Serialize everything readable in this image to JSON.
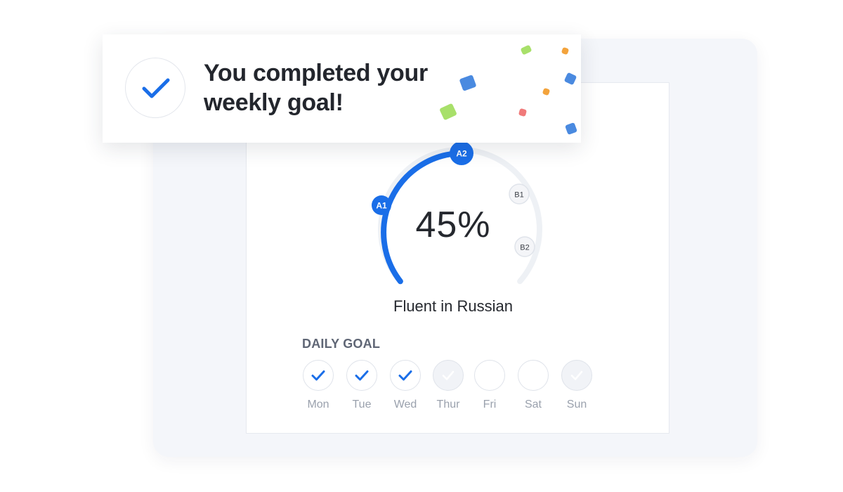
{
  "toast": {
    "title": "You completed your weekly goal!",
    "check_icon": "check-icon"
  },
  "progress": {
    "percent_label": "45%",
    "percent_value": 45,
    "level_label": "Fluent in Russian",
    "milestones": [
      {
        "label": "A1",
        "reached": true
      },
      {
        "label": "A2",
        "reached": true
      },
      {
        "label": "B1",
        "reached": false
      },
      {
        "label": "B2",
        "reached": false
      }
    ]
  },
  "daily_goal": {
    "label": "DAILY GOAL",
    "days": [
      {
        "name": "Mon",
        "state": "done"
      },
      {
        "name": "Tue",
        "state": "done"
      },
      {
        "name": "Wed",
        "state": "done"
      },
      {
        "name": "Thur",
        "state": "done-dim"
      },
      {
        "name": "Fri",
        "state": "empty"
      },
      {
        "name": "Sat",
        "state": "empty"
      },
      {
        "name": "Sun",
        "state": "done-dim"
      }
    ]
  },
  "colors": {
    "accent": "#1a6ee8",
    "track": "#eef1f5",
    "confetti": [
      "#4a8ae0",
      "#a8e06a",
      "#f3a33c",
      "#f07a7a"
    ]
  }
}
